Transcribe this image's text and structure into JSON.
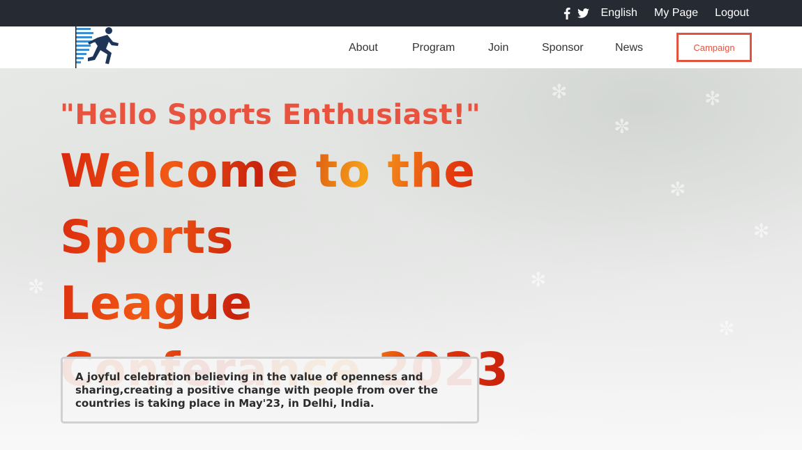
{
  "topbar": {
    "social": [
      {
        "icon": "facebook-icon"
      },
      {
        "icon": "twitter-icon"
      }
    ],
    "language": "English",
    "my_page": "My Page",
    "logout": "Logout"
  },
  "nav": {
    "items": [
      "About",
      "Program",
      "Join",
      "Sponsor",
      "News"
    ],
    "campaign": "Campaign"
  },
  "hero": {
    "greeting": "\"Hello Sports Enthusiast!\"",
    "headline_lines": [
      "Welcome to the Sports",
      "League",
      "Conferance 2023"
    ],
    "description": "A joyful celebration believing in the value of openness and sharing,creating a positive change with people from over the countries is taking place in May'23, in Delhi, India."
  },
  "colors": {
    "topbar_bg": "#262a33",
    "accent": "#e2533f",
    "headline_fire": "#e0300e"
  }
}
